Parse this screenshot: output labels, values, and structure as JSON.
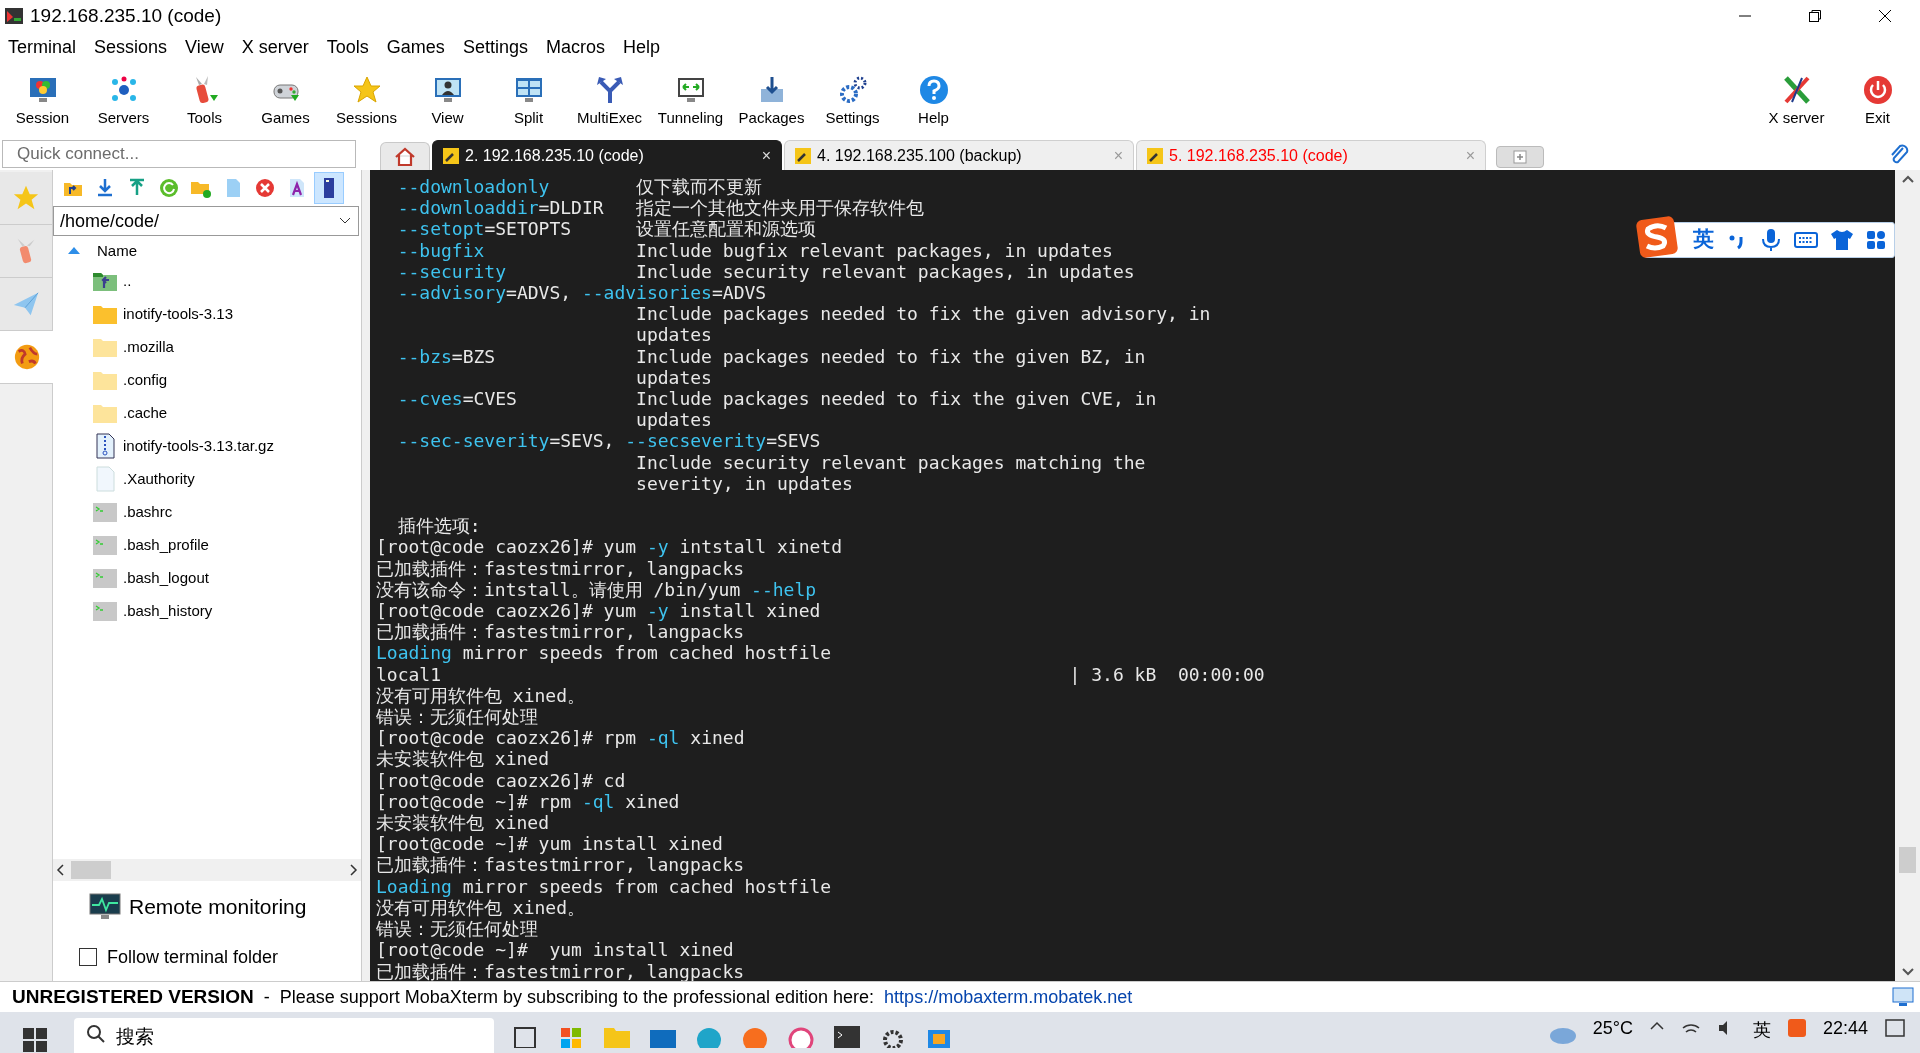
{
  "window": {
    "title": "192.168.235.10 (code)"
  },
  "menu": [
    "Terminal",
    "Sessions",
    "View",
    "X server",
    "Tools",
    "Games",
    "Settings",
    "Macros",
    "Help"
  ],
  "toolbar": [
    {
      "label": "Session",
      "kind": "session"
    },
    {
      "label": "Servers",
      "kind": "servers"
    },
    {
      "label": "Tools",
      "kind": "tools"
    },
    {
      "label": "Games",
      "kind": "games"
    },
    {
      "label": "Sessions",
      "kind": "sessions"
    },
    {
      "label": "View",
      "kind": "view"
    },
    {
      "label": "Split",
      "kind": "split"
    },
    {
      "label": "MultiExec",
      "kind": "multiexec"
    },
    {
      "label": "Tunneling",
      "kind": "tunneling"
    },
    {
      "label": "Packages",
      "kind": "packages"
    },
    {
      "label": "Settings",
      "kind": "settings"
    },
    {
      "label": "Help",
      "kind": "help"
    }
  ],
  "toolbar_right": [
    {
      "label": "X server",
      "kind": "xserver"
    },
    {
      "label": "Exit",
      "kind": "exit"
    }
  ],
  "quick_connect": {
    "placeholder": "Quick connect..."
  },
  "tabs": [
    {
      "label": "2. 192.168.235.10 (code)",
      "close": "×",
      "selected": true,
      "closed": false
    },
    {
      "label": "4. 192.168.235.100 (backup)",
      "close": "×",
      "selected": false,
      "closed": false
    },
    {
      "label": "5. 192.168.235.10 (code)",
      "close": "×",
      "selected": false,
      "closed": true
    }
  ],
  "side_tabs": [
    {
      "kind": "star",
      "selected": false
    },
    {
      "kind": "tools",
      "selected": false
    },
    {
      "kind": "send",
      "selected": false
    },
    {
      "kind": "sftp",
      "selected": true
    }
  ],
  "file_browser": {
    "tools": [
      {
        "kind": "up"
      },
      {
        "kind": "download"
      },
      {
        "kind": "upload"
      },
      {
        "kind": "refresh"
      },
      {
        "kind": "newfolder"
      },
      {
        "kind": "newfile"
      },
      {
        "kind": "delete"
      },
      {
        "kind": "rename"
      },
      {
        "kind": "terminal"
      }
    ],
    "path": "/home/code/",
    "column": "Name",
    "files": [
      {
        "name": "..",
        "kind": "parent"
      },
      {
        "name": "inotify-tools-3.13",
        "kind": "folder"
      },
      {
        "name": ".mozilla",
        "kind": "hidden-folder"
      },
      {
        "name": ".config",
        "kind": "hidden-folder"
      },
      {
        "name": ".cache",
        "kind": "hidden-folder"
      },
      {
        "name": "inotify-tools-3.13.tar.gz",
        "kind": "archive"
      },
      {
        "name": ".Xauthority",
        "kind": "file"
      },
      {
        "name": ".bashrc",
        "kind": "script"
      },
      {
        "name": ".bash_profile",
        "kind": "script"
      },
      {
        "name": ".bash_logout",
        "kind": "script"
      },
      {
        "name": ".bash_history",
        "kind": "script"
      }
    ],
    "remote_monitoring": "Remote monitoring",
    "follow": {
      "label": "Follow terminal folder",
      "checked": false
    }
  },
  "terminal": {
    "lines": [
      {
        "kind": "text",
        "segments": [
          {
            "text": "  --downloadonly",
            "hl": true
          },
          {
            "text": "        仅下载而不更新",
            "hl": false
          }
        ]
      },
      {
        "kind": "text",
        "segments": [
          {
            "text": "  --downloaddir",
            "hl": true
          },
          {
            "text": "=DLDIR   指定一个其他文件夹用于保存软件包",
            "hl": false
          }
        ]
      },
      {
        "kind": "text",
        "segments": [
          {
            "text": "  --setopt",
            "hl": true
          },
          {
            "text": "=SETOPTS      设置任意配置和源选项",
            "hl": false
          }
        ]
      },
      {
        "kind": "text",
        "segments": [
          {
            "text": "  --bugfix",
            "hl": true
          },
          {
            "text": "              Include bugfix relevant packages, in updates",
            "hl": false
          }
        ]
      },
      {
        "kind": "text",
        "segments": [
          {
            "text": "  --security",
            "hl": true
          },
          {
            "text": "            Include security relevant packages, in updates",
            "hl": false
          }
        ]
      },
      {
        "kind": "text",
        "segments": [
          {
            "text": "  --advisory",
            "hl": true
          },
          {
            "text": "=ADVS, ",
            "hl": false
          },
          {
            "text": "--advisories",
            "hl": true
          },
          {
            "text": "=ADVS",
            "hl": false
          }
        ]
      },
      {
        "kind": "text",
        "segments": [
          {
            "text": "                        Include packages needed to fix the given advisory, in",
            "hl": false
          }
        ]
      },
      {
        "kind": "text",
        "segments": [
          {
            "text": "                        updates",
            "hl": false
          }
        ]
      },
      {
        "kind": "text",
        "segments": [
          {
            "text": "  --bzs",
            "hl": true
          },
          {
            "text": "=BZS             Include packages needed to fix the given BZ, in",
            "hl": false
          }
        ]
      },
      {
        "kind": "text",
        "segments": [
          {
            "text": "                        updates",
            "hl": false
          }
        ]
      },
      {
        "kind": "text",
        "segments": [
          {
            "text": "  --cves",
            "hl": true
          },
          {
            "text": "=CVES           Include packages needed to fix the given CVE, in",
            "hl": false
          }
        ]
      },
      {
        "kind": "text",
        "segments": [
          {
            "text": "                        updates",
            "hl": false
          }
        ]
      },
      {
        "kind": "text",
        "segments": [
          {
            "text": "  --sec-severity",
            "hl": true
          },
          {
            "text": "=SEVS, ",
            "hl": false
          },
          {
            "text": "--secseverity",
            "hl": true
          },
          {
            "text": "=SEVS",
            "hl": false
          }
        ]
      },
      {
        "kind": "text",
        "segments": [
          {
            "text": "                        Include security relevant packages matching the",
            "hl": false
          }
        ]
      },
      {
        "kind": "text",
        "segments": [
          {
            "text": "                        severity, in updates",
            "hl": false
          }
        ]
      },
      {
        "kind": "blank"
      },
      {
        "kind": "text",
        "segments": [
          {
            "text": "  插件选项:",
            "hl": false
          }
        ]
      },
      {
        "kind": "text",
        "segments": [
          {
            "text": "[root@code caozx26]# yum ",
            "hl": false
          },
          {
            "text": "-y",
            "hl": true
          },
          {
            "text": " intstall xinetd",
            "hl": false
          }
        ]
      },
      {
        "kind": "text",
        "segments": [
          {
            "text": "已加载插件：fastestmirror, langpacks",
            "hl": false
          }
        ]
      },
      {
        "kind": "text",
        "segments": [
          {
            "text": "没有该命令：intstall。请使用 /bin/yum ",
            "hl": false
          },
          {
            "text": "--help",
            "hl": true
          }
        ]
      },
      {
        "kind": "text",
        "segments": [
          {
            "text": "[root@code caozx26]# yum ",
            "hl": false
          },
          {
            "text": "-y",
            "hl": true
          },
          {
            "text": " install xined",
            "hl": false
          }
        ]
      },
      {
        "kind": "text",
        "segments": [
          {
            "text": "已加载插件：fastestmirror, langpacks",
            "hl": false
          }
        ]
      },
      {
        "kind": "text",
        "segments": [
          {
            "text": "Loading",
            "hl": true
          },
          {
            "text": " mirror speeds from cached hostfile",
            "hl": false
          }
        ]
      },
      {
        "kind": "text",
        "segments": [
          {
            "text": "local1                                                          | 3.6 kB  00:00:00",
            "hl": false
          }
        ]
      },
      {
        "kind": "text",
        "segments": [
          {
            "text": "没有可用软件包 xined。",
            "hl": false
          }
        ]
      },
      {
        "kind": "text",
        "segments": [
          {
            "text": "错误：无须任何处理",
            "hl": false
          }
        ]
      },
      {
        "kind": "text",
        "segments": [
          {
            "text": "[root@code caozx26]# rpm ",
            "hl": false
          },
          {
            "text": "-ql",
            "hl": true
          },
          {
            "text": " xined",
            "hl": false
          }
        ]
      },
      {
        "kind": "text",
        "segments": [
          {
            "text": "未安装软件包 xined",
            "hl": false
          }
        ]
      },
      {
        "kind": "text",
        "segments": [
          {
            "text": "[root@code caozx26]# cd",
            "hl": false
          }
        ]
      },
      {
        "kind": "text",
        "segments": [
          {
            "text": "[root@code ~]# rpm ",
            "hl": false
          },
          {
            "text": "-ql",
            "hl": true
          },
          {
            "text": " xined",
            "hl": false
          }
        ]
      },
      {
        "kind": "text",
        "segments": [
          {
            "text": "未安装软件包 xined",
            "hl": false
          }
        ]
      },
      {
        "kind": "text",
        "segments": [
          {
            "text": "[root@code ~]# yum install xined",
            "hl": false
          }
        ]
      },
      {
        "kind": "text",
        "segments": [
          {
            "text": "已加载插件：fastestmirror, langpacks",
            "hl": false
          }
        ]
      },
      {
        "kind": "text",
        "segments": [
          {
            "text": "Loading",
            "hl": true
          },
          {
            "text": " mirror speeds from cached hostfile",
            "hl": false
          }
        ]
      },
      {
        "kind": "text",
        "segments": [
          {
            "text": "没有可用软件包 xined。",
            "hl": false
          }
        ]
      },
      {
        "kind": "text",
        "segments": [
          {
            "text": "错误：无须任何处理",
            "hl": false
          }
        ]
      },
      {
        "kind": "text",
        "segments": [
          {
            "text": "[root@code ~]#  yum install xined",
            "hl": false
          }
        ]
      },
      {
        "kind": "text",
        "segments": [
          {
            "text": "已加载插件：fastestmirror, langpacks",
            "hl": false
          }
        ]
      }
    ]
  },
  "ime": {
    "mode": "英"
  },
  "status_bar": {
    "label": "UNREGISTERED VERSION",
    "separator": "-",
    "message": "Please support MobaXterm by subscribing to the professional edition here:",
    "link": "https://mobaxterm.mobatek.net"
  },
  "taskbar": {
    "search": "搜索",
    "weather": "25°C",
    "language": "英",
    "time": "22:44"
  }
}
